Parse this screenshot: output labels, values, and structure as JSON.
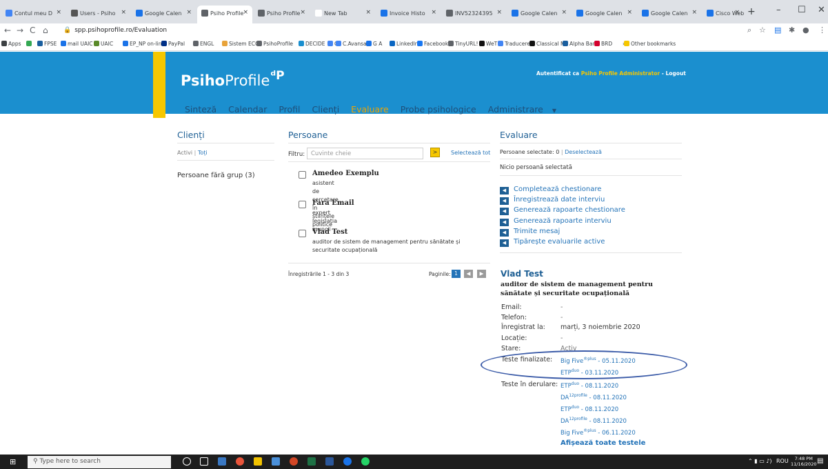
{
  "tabs": [
    {
      "label": "Contul meu D",
      "color": "#4285f4"
    },
    {
      "label": "Users - Psiho",
      "color": "#555555"
    },
    {
      "label": "Google Calen",
      "color": "#1a73e8"
    },
    {
      "label": "Psiho Profile",
      "color": "#5f6368"
    },
    {
      "label": "Psiho Profile",
      "color": "#5f6368"
    },
    {
      "label": "New Tab",
      "color": "#ffffff"
    },
    {
      "label": "Invoice Histo",
      "color": "#1a73e8"
    },
    {
      "label": "INV52324395",
      "color": "#5f6368"
    },
    {
      "label": "Google Calen",
      "color": "#1a73e8"
    },
    {
      "label": "Google Calen",
      "color": "#1a73e8"
    },
    {
      "label": "Google Calen",
      "color": "#1a73e8"
    },
    {
      "label": "Cisco Webex",
      "color": "#1a73e8"
    }
  ],
  "browser": {
    "url": "spp.psihoprofile.ro/Evaluation",
    "new_tab": "+",
    "minimize": "–",
    "maximize": "☐",
    "close": "✕"
  },
  "bookmarks": [
    {
      "label": "Apps",
      "color": "#3c4043"
    },
    {
      "label": "",
      "color": "#34a853"
    },
    {
      "label": "FPSE",
      "color": "#1a5e9e"
    },
    {
      "label": "mail UAIC",
      "color": "#1a73e8"
    },
    {
      "label": "UAIC",
      "color": "#5a8a2a"
    },
    {
      "label": "EP_NP on-line",
      "color": "#1a73e8"
    },
    {
      "label": "PayPal",
      "color": "#003087"
    },
    {
      "label": "ENGL",
      "color": "#5f6368"
    },
    {
      "label": "Sistem ECO",
      "color": "#e8a33a"
    },
    {
      "label": "PsihoProfile",
      "color": "#5f6368"
    },
    {
      "label": "DECIDE",
      "color": "#1a8fcf"
    },
    {
      "label": "G",
      "color": "#4285f4"
    },
    {
      "label": "C.Avansata",
      "color": "#4285f4"
    },
    {
      "label": "G A",
      "color": "#1a73e8"
    },
    {
      "label": "LinkedIn",
      "color": "#0a66c2"
    },
    {
      "label": "Facebook",
      "color": "#1877f2"
    },
    {
      "label": "TinyURL!",
      "color": "#5f6368"
    },
    {
      "label": "WeT",
      "color": "#111111"
    },
    {
      "label": "Traducere",
      "color": "#4285f4"
    },
    {
      "label": "Classical M",
      "color": "#111111"
    },
    {
      "label": "Alpha Bank",
      "color": "#1a5e9e"
    },
    {
      "label": "BRD",
      "color": "#d3002d"
    },
    {
      "label": "»",
      "color": "#ffffff"
    },
    {
      "label": "Other bookmarks",
      "color": "#f6c700"
    }
  ],
  "site": {
    "logo_bold": "Psiho",
    "logo_light": "Profile",
    "logo_mark": "ᵈP",
    "auth_prefix": "Autentificat ca",
    "auth_user": "Psiho Profile Administrator",
    "auth_sep": "-",
    "logout": "Logout"
  },
  "nav": [
    "Sinteză",
    "Calendar",
    "Profil",
    "Clienți",
    "Evaluare",
    "Probe psihologice",
    "Administrare"
  ],
  "clients": {
    "title": "Clienți",
    "filter_active": "Activi",
    "sep": "|",
    "filter_all": "Toți",
    "group": "Persoane fără grup (3)"
  },
  "persons": {
    "title": "Persoane",
    "filter_label": "Filtru:",
    "filter_placeholder": "Cuvinte cheie",
    "go": ">",
    "select_all": "Selectează tot",
    "items": [
      {
        "name": "Amedeo Exemplu",
        "role": "asistent de cercetare în științele politice"
      },
      {
        "name": "Fara Email",
        "role": "expert legislația muncii"
      },
      {
        "name": "Vlad Test",
        "role": "auditor de sistem de management pentru sănătate și securitate ocupațională"
      }
    ],
    "records": "Înregistrările 1 - 3 din 3",
    "pages_label": "Paginile:",
    "current_page": "1"
  },
  "evaluation": {
    "title": "Evaluare",
    "selected": "Persoane selectate: 0",
    "deselect": "Deselectează",
    "none_selected": "Nicio persoană selectată",
    "actions": [
      "Completează chestionare",
      "Înregistrează date interviu",
      "Generează rapoarte chestionare",
      "Generează rapoarte interviu",
      "Trimite mesaj",
      "Tipărește evaluarile active"
    ]
  },
  "detail": {
    "name": "Vlad Test",
    "role": "auditor de sistem de management pentru sănătate și securitate ocupațională",
    "email_label": "Email:",
    "email_value": "-",
    "phone_label": "Telefon:",
    "phone_value": "-",
    "registered_label": "Înregistrat la:",
    "registered_value": "marți, 3 noiembrie 2020",
    "location_label": "Locație:",
    "location_value": "-",
    "status_label": "Stare:",
    "status_value": "Activ",
    "finished_label": "Teste finalizate:",
    "finished": [
      {
        "name": "Big Five",
        "sup": "®plus",
        "date": "- 05.11.2020"
      },
      {
        "name": "ETP",
        "sup": "duo",
        "date": "- 03.11.2020"
      }
    ],
    "ongoing_label": "Teste în derulare:",
    "ongoing": [
      {
        "name": "ETP",
        "sup": "duo",
        "date": "- 08.11.2020"
      },
      {
        "name": "DA",
        "sup": "12profile",
        "date": "- 08.11.2020"
      },
      {
        "name": "ETP",
        "sup": "duo",
        "date": "- 08.11.2020"
      },
      {
        "name": "DA",
        "sup": "12profile",
        "date": "- 08.11.2020"
      },
      {
        "name": "Big Five",
        "sup": "®plus",
        "date": "- 06.11.2020"
      }
    ],
    "show_all": "Afișează toate testele"
  },
  "taskbar": {
    "search_placeholder": "Type here to search",
    "lang": "ROU",
    "time": "7:48 PM",
    "date": "11/16/2020"
  }
}
